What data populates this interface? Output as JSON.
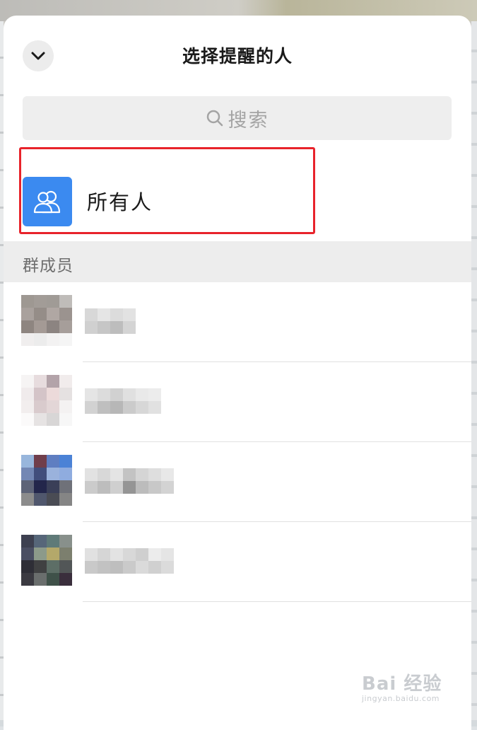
{
  "header": {
    "title": "选择提醒的人",
    "collapse_icon": "chevron-down-icon"
  },
  "search": {
    "placeholder": "搜索",
    "icon": "search-icon"
  },
  "everyone": {
    "label": "所有人",
    "icon": "group-users-icon",
    "avatar_color": "#3b8af0",
    "highlight_color": "#e8232b"
  },
  "section": {
    "label": "群成员"
  },
  "members": [
    {
      "name": "",
      "avatar_pixels": [
        "#9e9892",
        "#a29c97",
        "#a09b96",
        "#bfbcb9",
        "#a9a19d",
        "#958d88",
        "#b0a7a3",
        "#9b938f",
        "#8e8580",
        "#a49a95",
        "#8c8481",
        "#a69e9a",
        "#f0eeee",
        "#ececec",
        "#f3f2f2",
        "#f5f5f5"
      ],
      "name_pixels": [
        "#d8d8d8",
        "#d0d0d0",
        "#e5e5e5",
        "#c6c6c6",
        "#dcdcdc",
        "#bdbdbd",
        "#e2e2e2",
        "#d4d4d4"
      ]
    },
    {
      "name": "",
      "avatar_pixels": [
        "#f6f4f4",
        "#e7dcde",
        "#b3a3a9",
        "#f1ecec",
        "#f0ebec",
        "#d4c4c8",
        "#ecdada",
        "#e5e1e1",
        "#f2eeee",
        "#d9cbcd",
        "#e3d6d7",
        "#f4f2f2",
        "#fbfafa",
        "#e6e3e3",
        "#d8d6d6",
        "#f7f7f7"
      ],
      "name_pixels": [
        "#e5e5e5",
        "#d2d2d2",
        "#dcdcdc",
        "#bfbfbf",
        "#d1d1d1",
        "#b7b7b7",
        "#e0e0e0",
        "#cbcbcb",
        "#e9e9e9",
        "#d7d7d7",
        "#ececec",
        "#e1e1e1"
      ]
    },
    {
      "name": "",
      "avatar_pixels": [
        "#98b6dc",
        "#703e4b",
        "#5f7ec1",
        "#4b82d6",
        "#7387b4",
        "#414e7c",
        "#9ab2dc",
        "#8facdf",
        "#5d6377",
        "#23264b",
        "#3a3f58",
        "#6f7179",
        "#8c8c8c",
        "#50576d",
        "#4a4c54",
        "#858585"
      ],
      "name_pixels": [
        "#e2e2e2",
        "#cbcbcb",
        "#d8d8d8",
        "#bdbdbd",
        "#e4e4e4",
        "#cfcfcf",
        "#c3c3c3",
        "#959595",
        "#d5d5d5",
        "#bcbcbc",
        "#dedede",
        "#c8c8c8",
        "#e8e8e8",
        "#d3d3d3"
      ]
    },
    {
      "name": "",
      "avatar_pixels": [
        "#3d4050",
        "#566679",
        "#5f7a78",
        "#88908b",
        "#4a4e62",
        "#8c9a8a",
        "#b4a86a",
        "#7c7f6e",
        "#2e2e36",
        "#404142",
        "#5d6e66",
        "#525657",
        "#3b3a41",
        "#6a6e6d",
        "#3f5149",
        "#3a2e3c"
      ],
      "name_pixels": [
        "#e1e1e1",
        "#c9c9c9",
        "#d6d6d6",
        "#c2c2c2",
        "#e3e3e3",
        "#bebebe",
        "#d8d8d8",
        "#cacaca",
        "#cfcfcf",
        "#dadada",
        "#ececec",
        "#d0d0d0",
        "#e5e5e5",
        "#dbdbdb"
      ]
    }
  ],
  "watermark": {
    "main": "Bai 经验",
    "sub": "jingyan.baidu.com"
  }
}
